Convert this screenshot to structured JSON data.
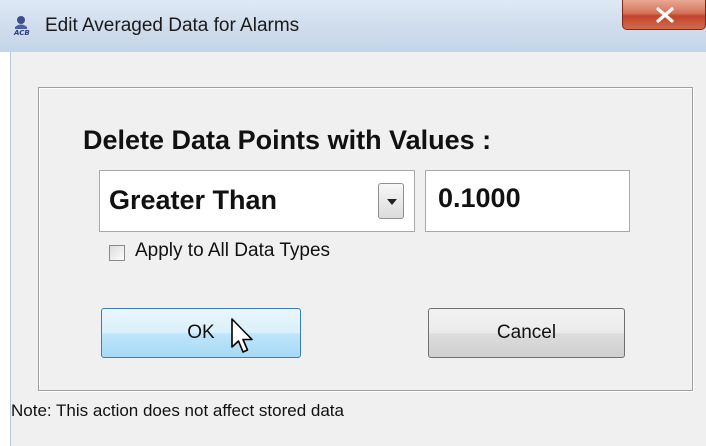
{
  "window": {
    "title": "Edit Averaged Data for Alarms",
    "icon": "app-logo-icon",
    "close_icon": "close-icon"
  },
  "dialog": {
    "heading": "Delete Data Points with Values :",
    "condition_select": {
      "selected": "Greater Than",
      "dropdown_icon": "chevron-down-icon"
    },
    "value_input": "0.1000",
    "apply_all_checkbox": {
      "label": "Apply to All Data Types",
      "checked": false
    },
    "ok_label": "OK",
    "cancel_label": "Cancel",
    "note": "Note: This action does not affect stored data"
  },
  "colors": {
    "close_button": "#c2452b",
    "ok_button_border": "#3c7fb1",
    "dialog_background": "#f0f0f0"
  }
}
